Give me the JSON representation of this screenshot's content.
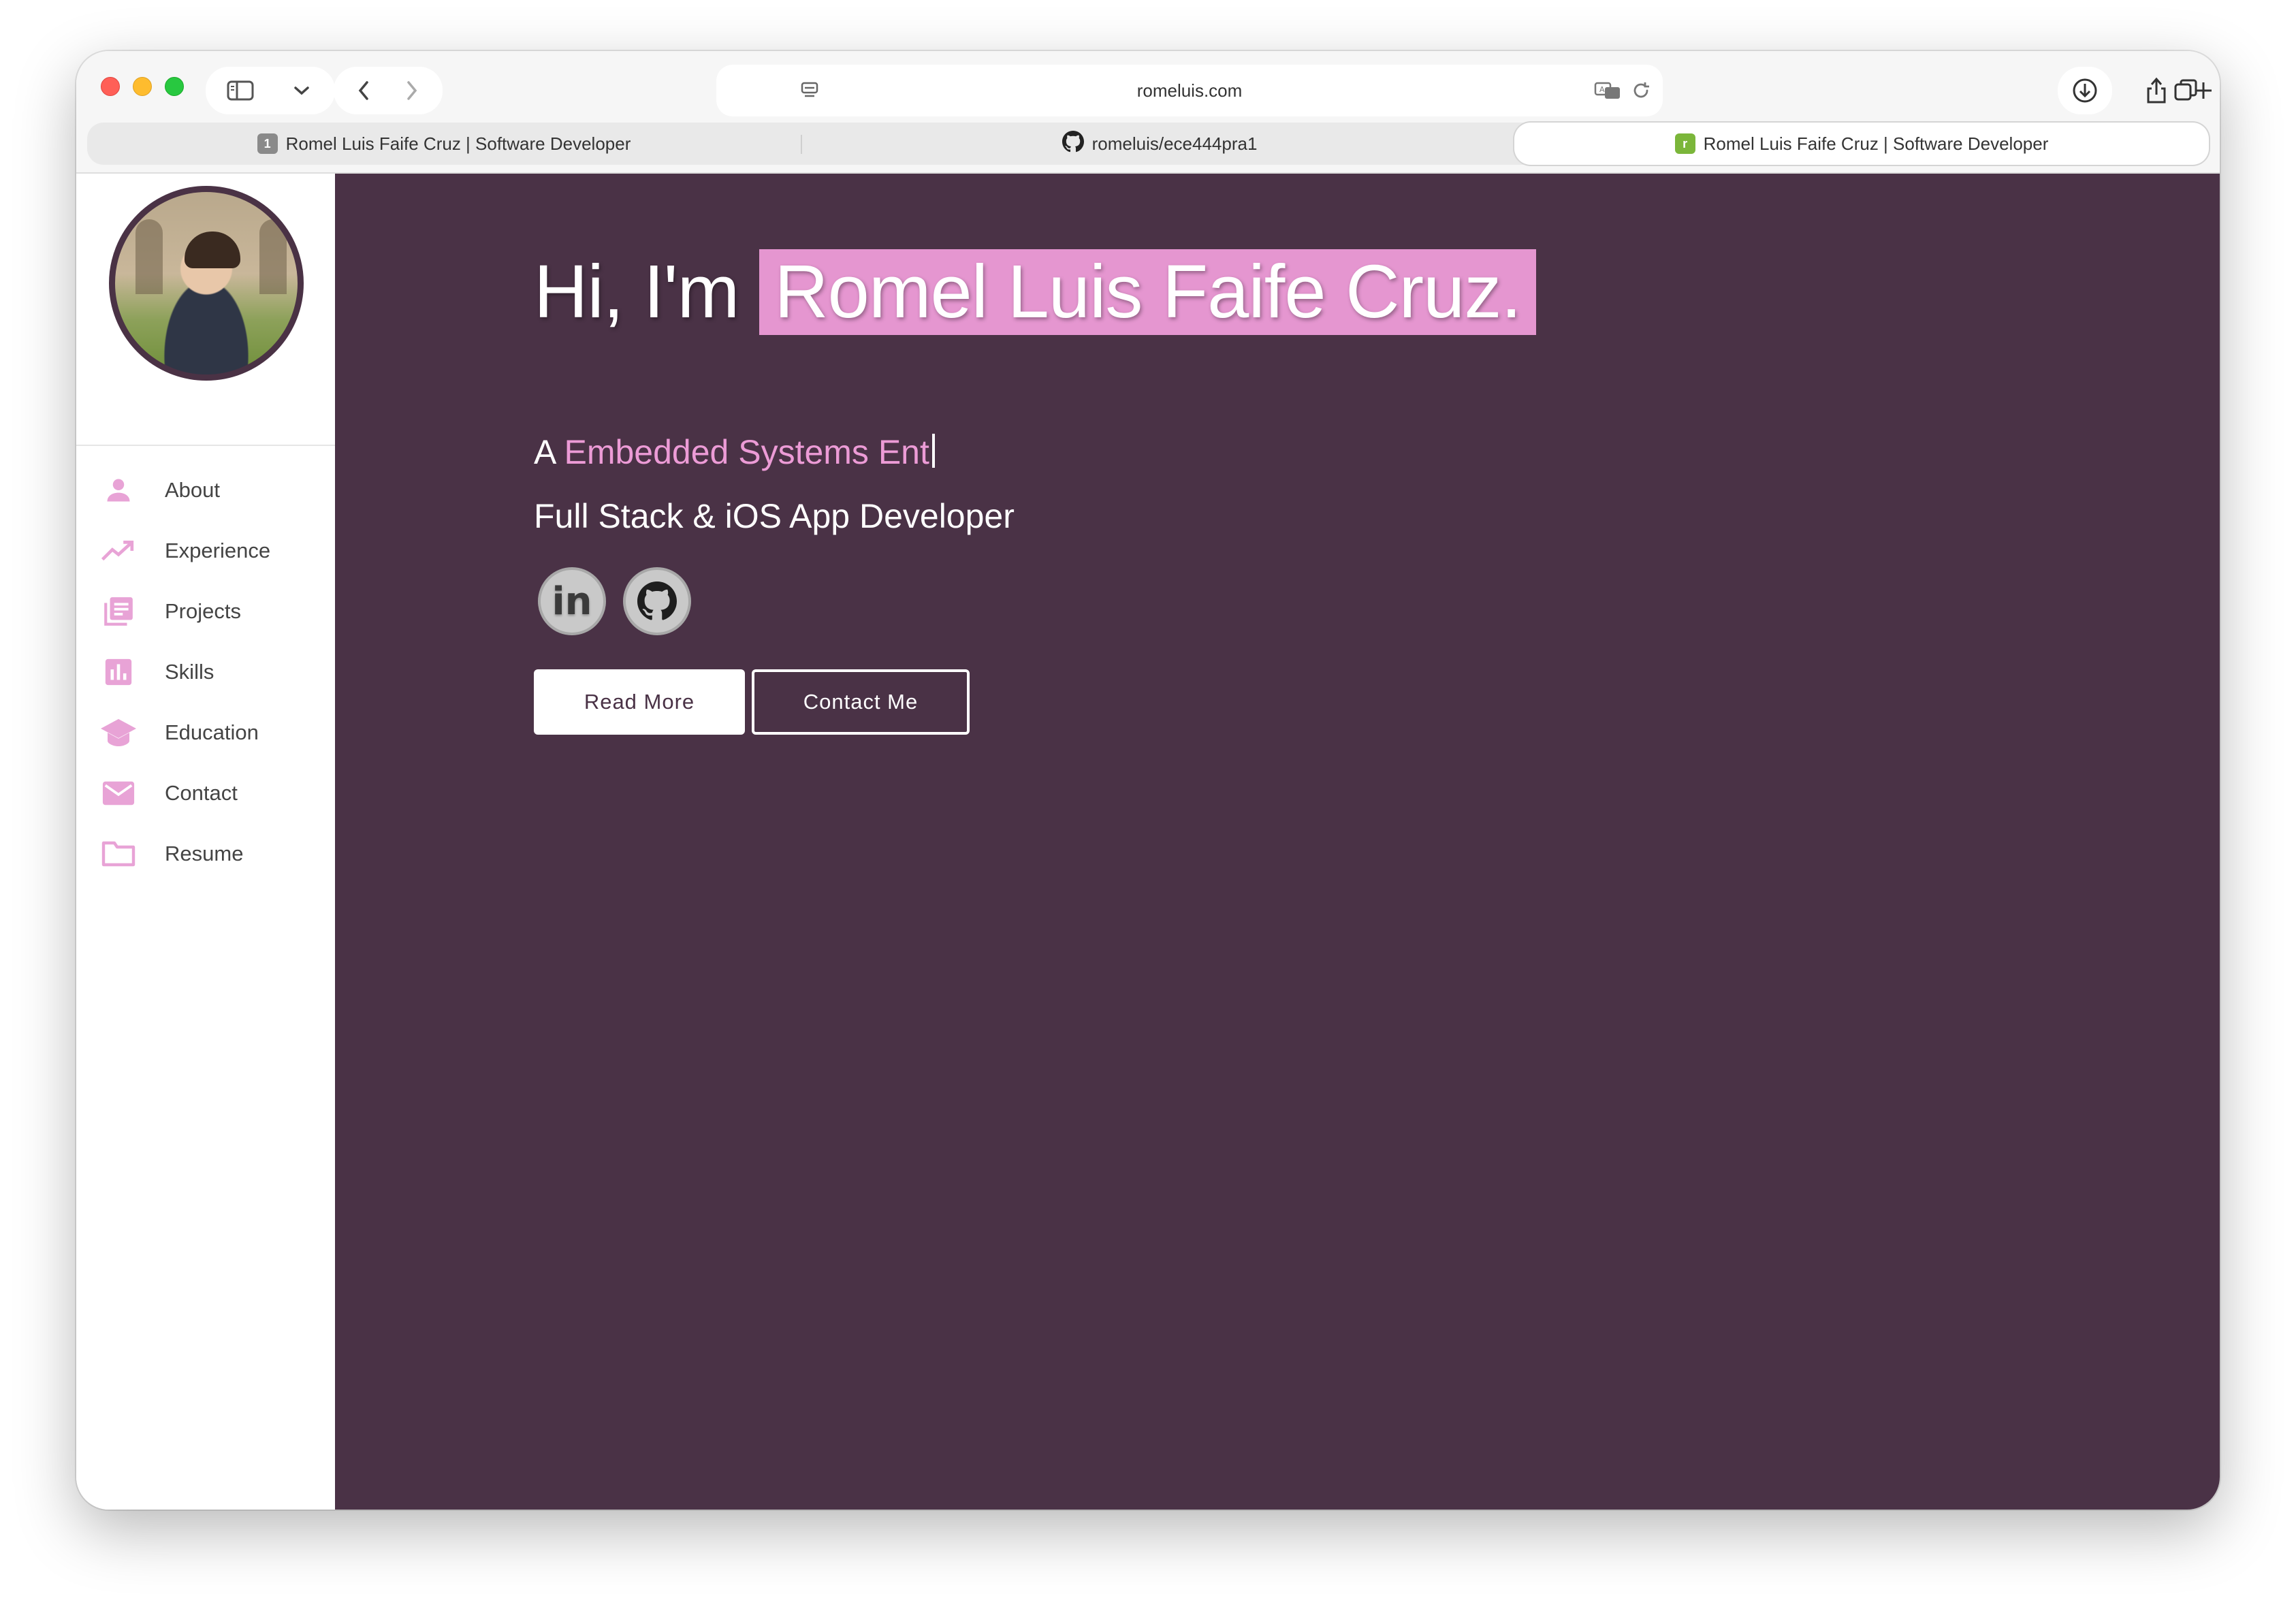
{
  "browser": {
    "address": "romeluis.com",
    "tabs": [
      {
        "label": "Romel Luis Faife Cruz | Software Developer",
        "favicon": "1"
      },
      {
        "label": "romeluis/ece444pra1",
        "favicon": "github-icon"
      },
      {
        "label": "Romel Luis Faife Cruz | Software Developer",
        "favicon": "r",
        "active": true
      }
    ]
  },
  "sidebar": {
    "items": [
      {
        "label": "About",
        "icon": "person-icon"
      },
      {
        "label": "Experience",
        "icon": "trending-up-icon"
      },
      {
        "label": "Projects",
        "icon": "library-books-icon"
      },
      {
        "label": "Skills",
        "icon": "bar-chart-icon"
      },
      {
        "label": "Education",
        "icon": "graduation-cap-icon"
      },
      {
        "label": "Contact",
        "icon": "mail-icon"
      },
      {
        "label": "Resume",
        "icon": "folder-icon"
      }
    ]
  },
  "hero": {
    "greeting": "Hi, I'm",
    "name": "Romel Luis Faife Cruz.",
    "typing_prefix": "A",
    "typing_text": "Embedded Systems Ent",
    "subtitle": "Full Stack & iOS App Developer",
    "socials": [
      {
        "label": "in",
        "icon": "linkedin-icon"
      },
      {
        "label": "",
        "icon": "github-icon"
      }
    ],
    "buttons": {
      "read_more": "Read More",
      "contact_me": "Contact Me"
    }
  },
  "colors": {
    "main_bg": "#4a3246",
    "accent": "#e596d0",
    "icon": "#e8a3d6"
  }
}
